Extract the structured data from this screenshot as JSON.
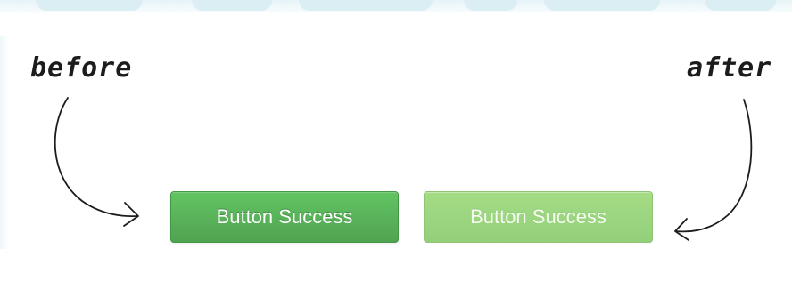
{
  "labels": {
    "before": "before",
    "after": "after"
  },
  "buttons": {
    "before_label": "Button Success",
    "after_label": "Button Success"
  },
  "colors": {
    "button_before": "#5cb85c",
    "button_after": "#9ed681",
    "ink": "#1c1c1c"
  },
  "icons": [
    "curved-arrow-icon",
    "curved-arrow-icon"
  ]
}
